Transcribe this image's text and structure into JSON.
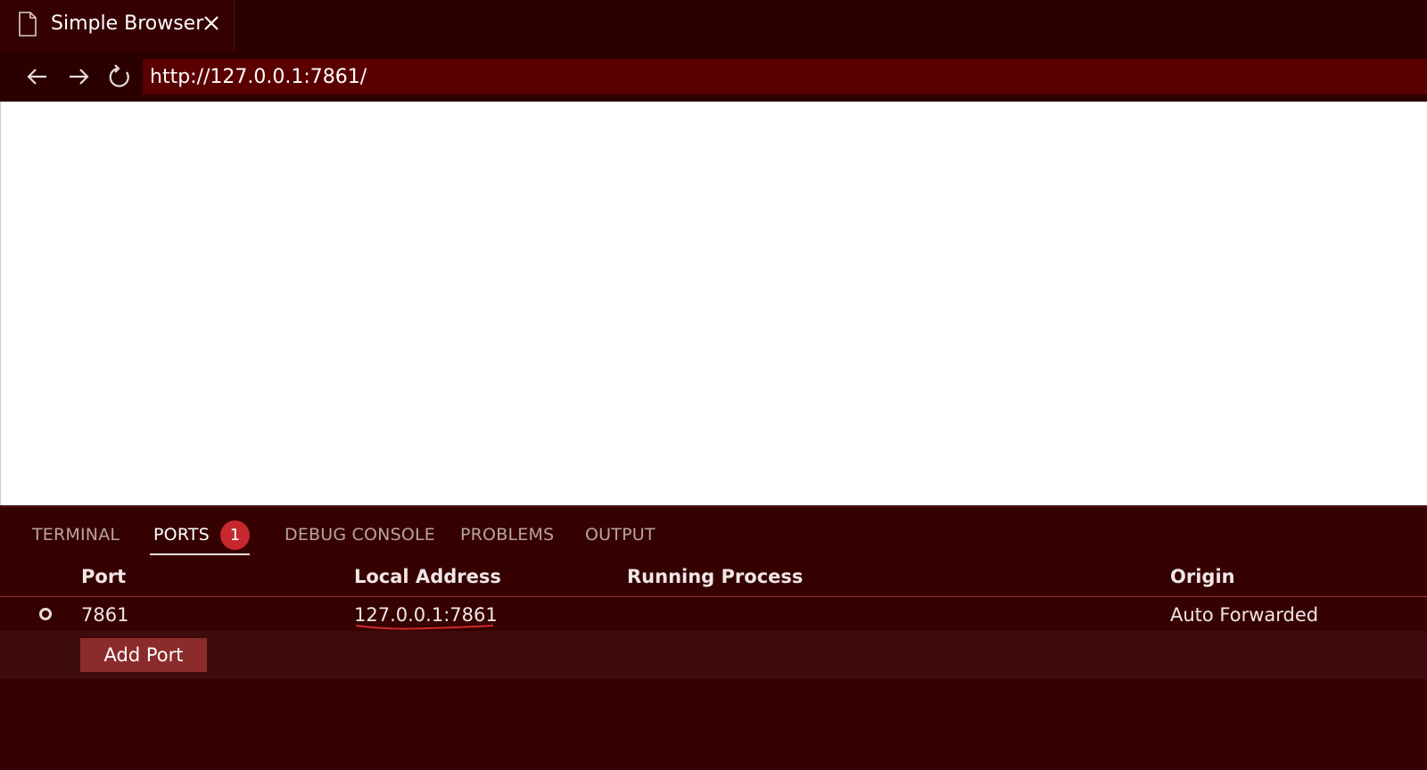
{
  "tab": {
    "title": "Simple Browser"
  },
  "address_bar": {
    "url": "http://127.0.0.1:7861/"
  },
  "panel": {
    "tabs": [
      {
        "label": "TERMINAL"
      },
      {
        "label": "PORTS",
        "badge": "1",
        "active": true
      },
      {
        "label": "DEBUG CONSOLE"
      },
      {
        "label": "PROBLEMS"
      },
      {
        "label": "OUTPUT"
      }
    ],
    "ports_table": {
      "columns": [
        "Port",
        "Local Address",
        "Running Process",
        "Origin"
      ],
      "rows": [
        {
          "port": "7861",
          "local_address": "127.0.0.1:7861",
          "running_process": "",
          "origin": "Auto Forwarded"
        }
      ],
      "add_port_label": "Add Port"
    }
  },
  "colors": {
    "chrome_bg": "#2b0000",
    "tab_bg": "#360101",
    "url_bar_bg": "#5a0000",
    "badge": "#c6282e",
    "button": "#8b2b2b",
    "squiggle": "#d02828"
  }
}
